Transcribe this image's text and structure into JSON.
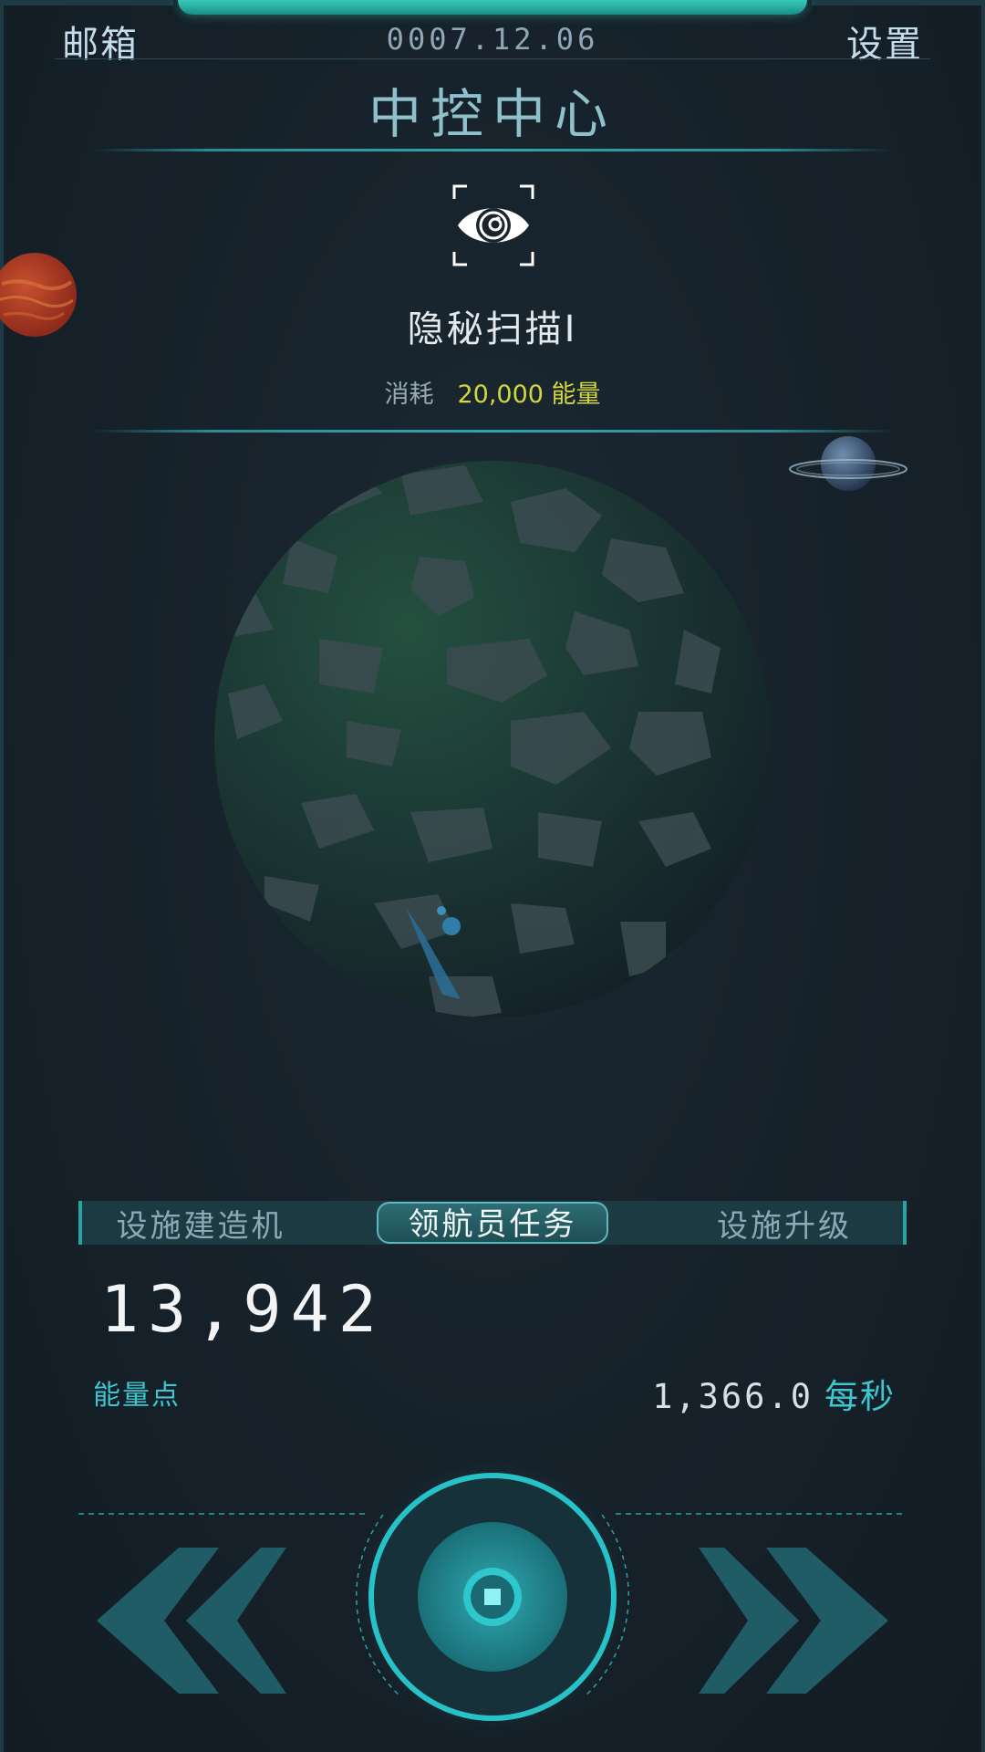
{
  "header": {
    "mail_label": "邮箱",
    "date": "0007.12.06",
    "settings_label": "设置",
    "title": "中控中心"
  },
  "scan": {
    "icon": "eye-scan-icon",
    "name": "隐秘扫描I",
    "cost_label": "消耗",
    "cost_value": "20,000 能量"
  },
  "tabs": [
    {
      "label": "设施建造机",
      "active": false
    },
    {
      "label": "领航员任务",
      "active": true
    },
    {
      "label": "设施升级",
      "active": false
    }
  ],
  "resources": {
    "energy_points": "13,942",
    "energy_label": "能量点",
    "rate_value": "1,366.0",
    "rate_unit": "每秒"
  },
  "controls": {
    "prev_icon": "double-chevron-left-icon",
    "next_icon": "double-chevron-right-icon",
    "center_icon": "target-icon"
  },
  "colors": {
    "accent": "#3cc6cf",
    "cost_highlight": "#d2d83c",
    "background": "#17212a"
  }
}
